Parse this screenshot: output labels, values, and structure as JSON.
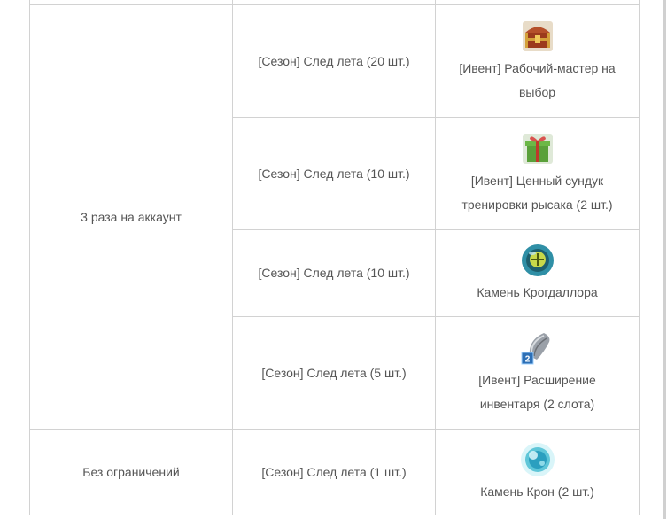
{
  "table": {
    "group_limited": {
      "limit_label": "3 раза на аккаунт",
      "rows": [
        {
          "cost": "[Сезон] След лета (20 шт.)",
          "reward": "[Ивент] Рабочий-мастер на выбор",
          "icon": "treasure-chest-icon"
        },
        {
          "cost": "[Сезон] След лета (10 шт.)",
          "reward": "[Ивент] Ценный сундук тренировки рысака (2 шт.)",
          "icon": "gift-box-icon"
        },
        {
          "cost": "[Сезон] След лета (10 шт.)",
          "reward": "Камень Крогдаллора",
          "icon": "green-orb-icon"
        },
        {
          "cost": "[Сезон] След лета (5 шт.)",
          "reward": "[Ивент] Расширение инвентаря (2 слота)",
          "icon": "bag-expansion-icon",
          "icon_badge": "2"
        }
      ]
    },
    "group_unlimited": {
      "limit_label": "Без ограничений",
      "rows": [
        {
          "cost": "[Сезон] След лета (1 шт.)",
          "reward": "Камень Крон (2 шт.)",
          "icon": "crystal-stone-icon"
        }
      ]
    }
  },
  "colors": {
    "border": "#d2d2d2",
    "text": "#555555",
    "frame": "#d0d0d0"
  }
}
